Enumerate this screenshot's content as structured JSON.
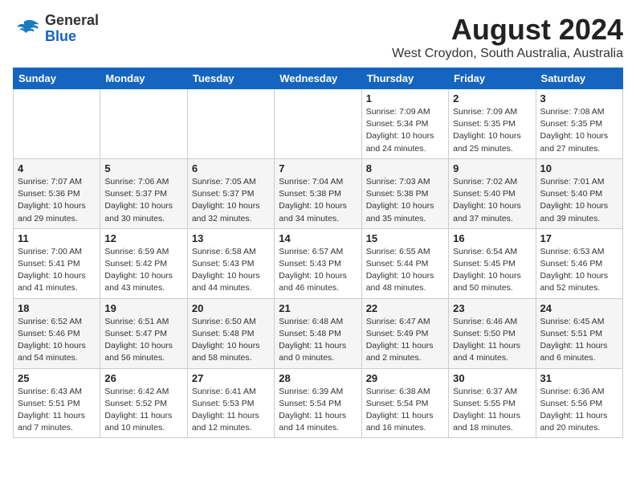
{
  "header": {
    "logo": {
      "line1": "General",
      "line2": "Blue"
    },
    "month_year": "August 2024",
    "location": "West Croydon, South Australia, Australia"
  },
  "weekdays": [
    "Sunday",
    "Monday",
    "Tuesday",
    "Wednesday",
    "Thursday",
    "Friday",
    "Saturday"
  ],
  "weeks": [
    [
      {
        "day": "",
        "info": ""
      },
      {
        "day": "",
        "info": ""
      },
      {
        "day": "",
        "info": ""
      },
      {
        "day": "",
        "info": ""
      },
      {
        "day": "1",
        "info": "Sunrise: 7:09 AM\nSunset: 5:34 PM\nDaylight: 10 hours\nand 24 minutes."
      },
      {
        "day": "2",
        "info": "Sunrise: 7:09 AM\nSunset: 5:35 PM\nDaylight: 10 hours\nand 25 minutes."
      },
      {
        "day": "3",
        "info": "Sunrise: 7:08 AM\nSunset: 5:35 PM\nDaylight: 10 hours\nand 27 minutes."
      }
    ],
    [
      {
        "day": "4",
        "info": "Sunrise: 7:07 AM\nSunset: 5:36 PM\nDaylight: 10 hours\nand 29 minutes."
      },
      {
        "day": "5",
        "info": "Sunrise: 7:06 AM\nSunset: 5:37 PM\nDaylight: 10 hours\nand 30 minutes."
      },
      {
        "day": "6",
        "info": "Sunrise: 7:05 AM\nSunset: 5:37 PM\nDaylight: 10 hours\nand 32 minutes."
      },
      {
        "day": "7",
        "info": "Sunrise: 7:04 AM\nSunset: 5:38 PM\nDaylight: 10 hours\nand 34 minutes."
      },
      {
        "day": "8",
        "info": "Sunrise: 7:03 AM\nSunset: 5:38 PM\nDaylight: 10 hours\nand 35 minutes."
      },
      {
        "day": "9",
        "info": "Sunrise: 7:02 AM\nSunset: 5:40 PM\nDaylight: 10 hours\nand 37 minutes."
      },
      {
        "day": "10",
        "info": "Sunrise: 7:01 AM\nSunset: 5:40 PM\nDaylight: 10 hours\nand 39 minutes."
      }
    ],
    [
      {
        "day": "11",
        "info": "Sunrise: 7:00 AM\nSunset: 5:41 PM\nDaylight: 10 hours\nand 41 minutes."
      },
      {
        "day": "12",
        "info": "Sunrise: 6:59 AM\nSunset: 5:42 PM\nDaylight: 10 hours\nand 43 minutes."
      },
      {
        "day": "13",
        "info": "Sunrise: 6:58 AM\nSunset: 5:43 PM\nDaylight: 10 hours\nand 44 minutes."
      },
      {
        "day": "14",
        "info": "Sunrise: 6:57 AM\nSunset: 5:43 PM\nDaylight: 10 hours\nand 46 minutes."
      },
      {
        "day": "15",
        "info": "Sunrise: 6:55 AM\nSunset: 5:44 PM\nDaylight: 10 hours\nand 48 minutes."
      },
      {
        "day": "16",
        "info": "Sunrise: 6:54 AM\nSunset: 5:45 PM\nDaylight: 10 hours\nand 50 minutes."
      },
      {
        "day": "17",
        "info": "Sunrise: 6:53 AM\nSunset: 5:46 PM\nDaylight: 10 hours\nand 52 minutes."
      }
    ],
    [
      {
        "day": "18",
        "info": "Sunrise: 6:52 AM\nSunset: 5:46 PM\nDaylight: 10 hours\nand 54 minutes."
      },
      {
        "day": "19",
        "info": "Sunrise: 6:51 AM\nSunset: 5:47 PM\nDaylight: 10 hours\nand 56 minutes."
      },
      {
        "day": "20",
        "info": "Sunrise: 6:50 AM\nSunset: 5:48 PM\nDaylight: 10 hours\nand 58 minutes."
      },
      {
        "day": "21",
        "info": "Sunrise: 6:48 AM\nSunset: 5:48 PM\nDaylight: 11 hours\nand 0 minutes."
      },
      {
        "day": "22",
        "info": "Sunrise: 6:47 AM\nSunset: 5:49 PM\nDaylight: 11 hours\nand 2 minutes."
      },
      {
        "day": "23",
        "info": "Sunrise: 6:46 AM\nSunset: 5:50 PM\nDaylight: 11 hours\nand 4 minutes."
      },
      {
        "day": "24",
        "info": "Sunrise: 6:45 AM\nSunset: 5:51 PM\nDaylight: 11 hours\nand 6 minutes."
      }
    ],
    [
      {
        "day": "25",
        "info": "Sunrise: 6:43 AM\nSunset: 5:51 PM\nDaylight: 11 hours\nand 7 minutes."
      },
      {
        "day": "26",
        "info": "Sunrise: 6:42 AM\nSunset: 5:52 PM\nDaylight: 11 hours\nand 10 minutes."
      },
      {
        "day": "27",
        "info": "Sunrise: 6:41 AM\nSunset: 5:53 PM\nDaylight: 11 hours\nand 12 minutes."
      },
      {
        "day": "28",
        "info": "Sunrise: 6:39 AM\nSunset: 5:54 PM\nDaylight: 11 hours\nand 14 minutes."
      },
      {
        "day": "29",
        "info": "Sunrise: 6:38 AM\nSunset: 5:54 PM\nDaylight: 11 hours\nand 16 minutes."
      },
      {
        "day": "30",
        "info": "Sunrise: 6:37 AM\nSunset: 5:55 PM\nDaylight: 11 hours\nand 18 minutes."
      },
      {
        "day": "31",
        "info": "Sunrise: 6:36 AM\nSunset: 5:56 PM\nDaylight: 11 hours\nand 20 minutes."
      }
    ]
  ]
}
